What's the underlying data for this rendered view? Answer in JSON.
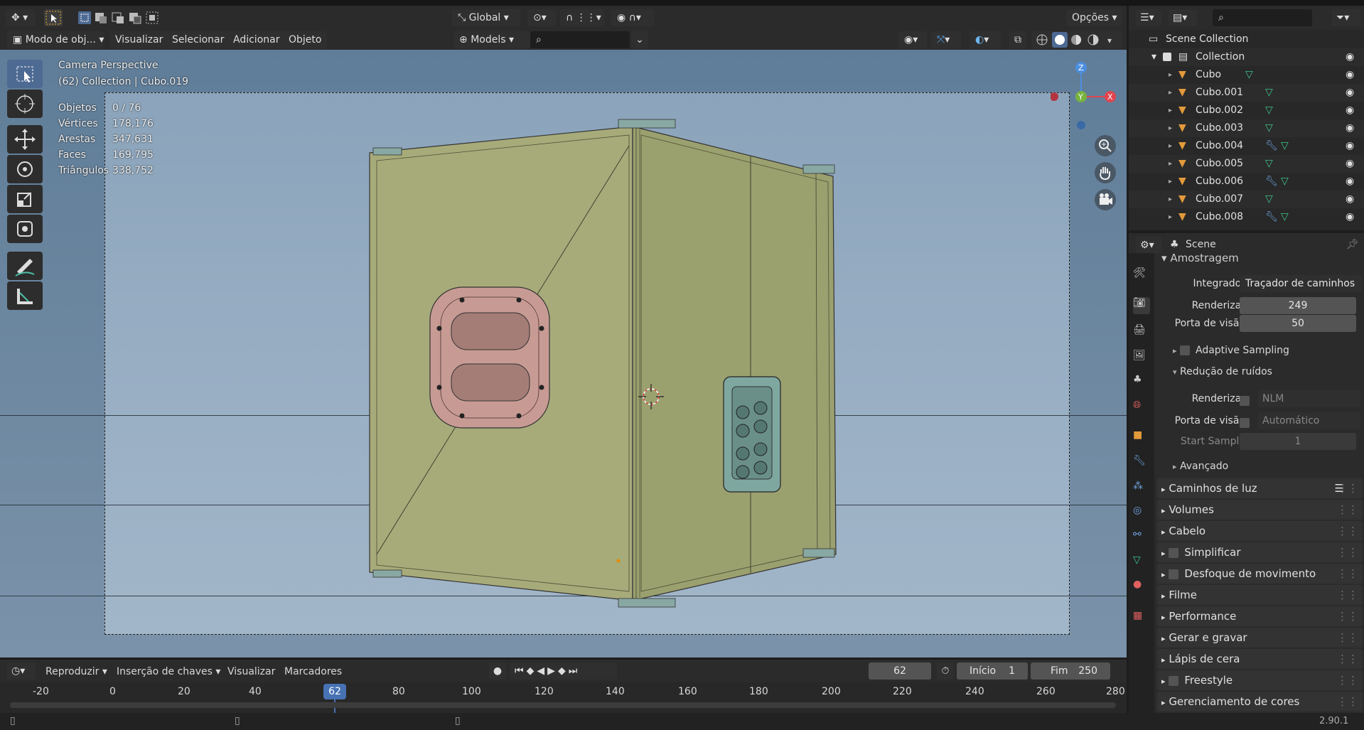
{
  "header": {
    "mode_label": "Modo de obj...",
    "menus": [
      "Visualizar",
      "Selecionar",
      "Adicionar",
      "Objeto"
    ],
    "transform_orientation": "Global",
    "options_label": "Opções",
    "collection_filter": "Models"
  },
  "viewport": {
    "camera_title": "Camera Perspective",
    "camera_subtitle": "(62) Collection | Cubo.019",
    "stats": [
      {
        "label": "Objetos",
        "value": "0 / 76"
      },
      {
        "label": "Vértices",
        "value": "178,176"
      },
      {
        "label": "Arestas",
        "value": "347,631"
      },
      {
        "label": "Faces",
        "value": "169,795"
      },
      {
        "label": "Triângulos",
        "value": "338,752"
      }
    ],
    "gizmo": {
      "x": "X",
      "y": "Y",
      "z": "Z"
    }
  },
  "outliner": {
    "root": "Scene Collection",
    "collection": "Collection",
    "items": [
      {
        "name": "Cubo",
        "wrench": false
      },
      {
        "name": "Cubo.001",
        "wrench": false
      },
      {
        "name": "Cubo.002",
        "wrench": false
      },
      {
        "name": "Cubo.003",
        "wrench": false
      },
      {
        "name": "Cubo.004",
        "wrench": true
      },
      {
        "name": "Cubo.005",
        "wrench": false
      },
      {
        "name": "Cubo.006",
        "wrench": true
      },
      {
        "name": "Cubo.007",
        "wrench": false
      },
      {
        "name": "Cubo.008",
        "wrench": true
      }
    ]
  },
  "properties": {
    "scene_label": "Scene",
    "section_title": "Amostragem",
    "integrator_label": "Integrador",
    "integrator_value": "Traçador de caminhos",
    "render_label": "Renderizar",
    "render_value": "249",
    "viewport_label": "Porta de visão",
    "viewport_value": "50",
    "adaptive_sampling": "Adaptive Sampling",
    "denoise_title": "Redução de ruídos",
    "denoise_render_label": "Renderizar",
    "denoise_render_value": "NLM",
    "denoise_viewport_label": "Porta de visão",
    "denoise_viewport_value": "Automático",
    "start_sample_label": "Start Sample",
    "start_sample_value": "1",
    "advanced": "Avançado",
    "panels": [
      {
        "label": "Caminhos de luz",
        "checkbox": false
      },
      {
        "label": "Volumes",
        "checkbox": false
      },
      {
        "label": "Cabelo",
        "checkbox": false
      },
      {
        "label": "Simplificar",
        "checkbox": true
      },
      {
        "label": "Desfoque de movimento",
        "checkbox": true
      },
      {
        "label": "Filme",
        "checkbox": false
      },
      {
        "label": "Performance",
        "checkbox": false
      },
      {
        "label": "Gerar e gravar",
        "checkbox": false
      },
      {
        "label": "Lápis de cera",
        "checkbox": false
      },
      {
        "label": "Freestyle",
        "checkbox": true
      },
      {
        "label": "Gerenciamento de cores",
        "checkbox": false
      }
    ]
  },
  "timeline": {
    "menus": [
      "Reproduzir",
      "Inserção de chaves",
      "Visualizar",
      "Marcadores"
    ],
    "current_frame": "62",
    "start_label": "Início",
    "start_value": "1",
    "end_label": "Fim",
    "end_value": "250",
    "ruler": [
      "-20",
      "0",
      "20",
      "40",
      "80",
      "100",
      "120",
      "140",
      "160",
      "180",
      "200",
      "220",
      "240",
      "260",
      "280"
    ]
  },
  "status": {
    "version": "2.90.1"
  },
  "colors": {
    "accent": "#4d6a93",
    "frame_marker": "#4772b3",
    "model_face": "#a7ab7a",
    "port_pink": "#c79b94",
    "connector_teal": "#7ea7a0"
  }
}
